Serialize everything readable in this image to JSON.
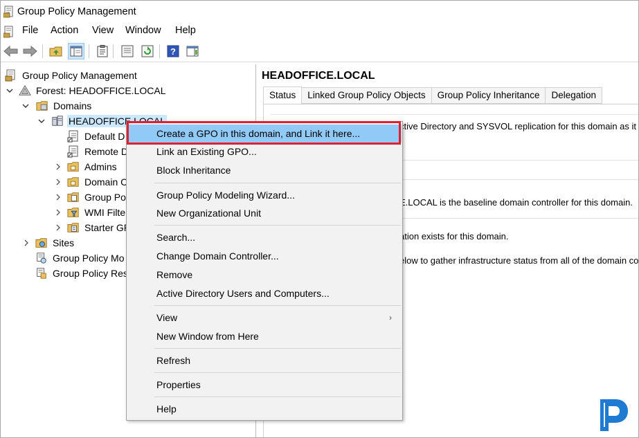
{
  "window": {
    "title": "Group Policy Management"
  },
  "menu": [
    "File",
    "Action",
    "View",
    "Window",
    "Help"
  ],
  "toolbar": {
    "icons": [
      "back-arrow-icon",
      "forward-arrow-icon",
      "up-folder-icon",
      "show-hide-tree-icon",
      "clipboard-icon",
      "properties-icon",
      "refresh-icon",
      "help-icon",
      "action-pane-icon"
    ]
  },
  "tree": {
    "root": "Group Policy Management",
    "forest": "Forest: HEADOFFICE.LOCAL",
    "domains": "Domains",
    "domain": "HEADOFFICE.LOCAL",
    "children": [
      "Default D",
      "Remote D",
      "Admins",
      "Domain C",
      "Group Po",
      "WMI Filte",
      "Starter GP"
    ],
    "sites": "Sites",
    "modeling": "Group Policy Mo",
    "results": "Group Policy Res"
  },
  "right_pane": {
    "title": "HEADOFFICE.LOCAL",
    "tabs": [
      "Status",
      "Linked Group Policy Objects",
      "Group Policy Inheritance",
      "Delegation"
    ],
    "lines": [
      "ctive Directory and SYSVOL replication for this domain as it",
      "E.LOCAL is the baseline domain controller for this domain.",
      "ation exists for this domain.",
      "elow to gather infrastructure status from all of the domain co"
    ]
  },
  "context_menu": {
    "items": [
      "Create a GPO in this domain, and Link it here...",
      "Link an Existing GPO...",
      "Block Inheritance",
      "Group Policy Modeling Wizard...",
      "New Organizational Unit",
      "Search...",
      "Change Domain Controller...",
      "Remove",
      "Active Directory Users and Computers...",
      "View",
      "New Window from Here",
      "Refresh",
      "Properties",
      "Help"
    ],
    "submenu_arrow": "›"
  },
  "colors": {
    "highlight": "#91c9f7",
    "callout": "#e0202e",
    "logo_blue": "#1e7bd1"
  }
}
